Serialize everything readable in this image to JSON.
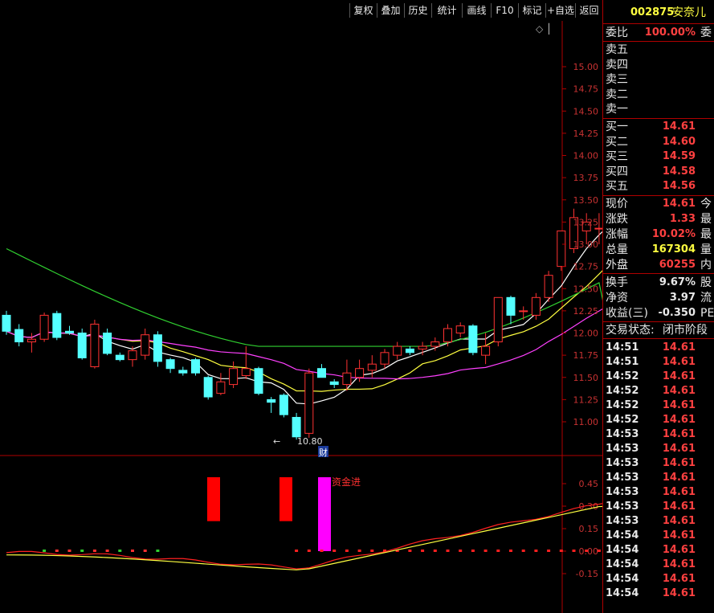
{
  "toolbar": {
    "buttons": [
      "复权",
      "叠加",
      "历史",
      "统计",
      "画线",
      "F10",
      "标记",
      "+自选",
      "返回"
    ]
  },
  "chart": {
    "price_ticks": [
      "15.00",
      "14.75",
      "14.50",
      "14.25",
      "14.00",
      "13.75",
      "13.50",
      "13.25",
      "13.00",
      "12.75",
      "12.50",
      "12.25",
      "12.00",
      "11.75",
      "11.50",
      "11.25",
      "11.00"
    ],
    "low_marker": "10.80",
    "finance_badge": "财",
    "signal_label": "资金进",
    "indicator_ticks": [
      "0.45",
      "0.30",
      "0.15",
      "0.00",
      "-0.15"
    ],
    "diamond_icon": "◇",
    "bar_icon": "▏"
  },
  "chart_data": {
    "type": "candlestick",
    "price_range": [
      10.75,
      15.25
    ],
    "candles": [
      {
        "o": 12.2,
        "h": 12.25,
        "l": 11.98,
        "c": 12.02
      },
      {
        "o": 12.04,
        "h": 12.1,
        "l": 11.85,
        "c": 11.9
      },
      {
        "o": 11.9,
        "h": 12.0,
        "l": 11.78,
        "c": 11.93
      },
      {
        "o": 11.93,
        "h": 12.23,
        "l": 11.9,
        "c": 12.2
      },
      {
        "o": 12.22,
        "h": 12.25,
        "l": 11.92,
        "c": 11.95
      },
      {
        "o": 12.02,
        "h": 12.08,
        "l": 11.98,
        "c": 12.0
      },
      {
        "o": 12.0,
        "h": 12.05,
        "l": 11.7,
        "c": 11.72
      },
      {
        "o": 11.62,
        "h": 12.15,
        "l": 11.6,
        "c": 12.1
      },
      {
        "o": 12.0,
        "h": 12.05,
        "l": 11.75,
        "c": 11.77
      },
      {
        "o": 11.75,
        "h": 11.78,
        "l": 11.68,
        "c": 11.7
      },
      {
        "o": 11.7,
        "h": 11.85,
        "l": 11.62,
        "c": 11.8
      },
      {
        "o": 11.75,
        "h": 12.05,
        "l": 11.7,
        "c": 11.98
      },
      {
        "o": 11.98,
        "h": 12.02,
        "l": 11.62,
        "c": 11.68
      },
      {
        "o": 11.7,
        "h": 11.72,
        "l": 11.55,
        "c": 11.6
      },
      {
        "o": 11.58,
        "h": 11.62,
        "l": 11.52,
        "c": 11.55
      },
      {
        "o": 11.7,
        "h": 11.72,
        "l": 11.52,
        "c": 11.55
      },
      {
        "o": 11.5,
        "h": 11.52,
        "l": 11.25,
        "c": 11.28
      },
      {
        "o": 11.32,
        "h": 11.55,
        "l": 11.3,
        "c": 11.45
      },
      {
        "o": 11.42,
        "h": 11.68,
        "l": 11.38,
        "c": 11.6
      },
      {
        "o": 11.52,
        "h": 11.85,
        "l": 11.48,
        "c": 11.6
      },
      {
        "o": 11.6,
        "h": 11.62,
        "l": 11.3,
        "c": 11.32
      },
      {
        "o": 11.25,
        "h": 11.28,
        "l": 11.1,
        "c": 11.22
      },
      {
        "o": 11.3,
        "h": 11.32,
        "l": 11.05,
        "c": 11.08
      },
      {
        "o": 11.05,
        "h": 11.1,
        "l": 10.8,
        "c": 10.83
      },
      {
        "o": 10.87,
        "h": 11.6,
        "l": 10.82,
        "c": 11.55
      },
      {
        "o": 11.6,
        "h": 11.65,
        "l": 11.5,
        "c": 11.5
      },
      {
        "o": 11.45,
        "h": 11.48,
        "l": 11.38,
        "c": 11.42
      },
      {
        "o": 11.42,
        "h": 11.7,
        "l": 11.35,
        "c": 11.55
      },
      {
        "o": 11.5,
        "h": 11.7,
        "l": 11.45,
        "c": 11.6
      },
      {
        "o": 11.58,
        "h": 11.75,
        "l": 11.5,
        "c": 11.65
      },
      {
        "o": 11.65,
        "h": 11.82,
        "l": 11.6,
        "c": 11.78
      },
      {
        "o": 11.75,
        "h": 11.9,
        "l": 11.7,
        "c": 11.85
      },
      {
        "o": 11.82,
        "h": 11.85,
        "l": 11.75,
        "c": 11.78
      },
      {
        "o": 11.82,
        "h": 11.9,
        "l": 11.75,
        "c": 11.85
      },
      {
        "o": 11.85,
        "h": 11.95,
        "l": 11.8,
        "c": 11.9
      },
      {
        "o": 11.9,
        "h": 12.1,
        "l": 11.85,
        "c": 12.05
      },
      {
        "o": 12.0,
        "h": 12.12,
        "l": 11.95,
        "c": 12.08
      },
      {
        "o": 12.08,
        "h": 12.1,
        "l": 11.75,
        "c": 11.78
      },
      {
        "o": 11.75,
        "h": 12.0,
        "l": 11.65,
        "c": 11.85
      },
      {
        "o": 11.9,
        "h": 12.4,
        "l": 11.85,
        "c": 12.4
      },
      {
        "o": 12.4,
        "h": 12.42,
        "l": 12.1,
        "c": 12.2
      },
      {
        "o": 12.25,
        "h": 12.3,
        "l": 12.15,
        "c": 12.25
      },
      {
        "o": 12.2,
        "h": 12.45,
        "l": 12.15,
        "c": 12.4
      },
      {
        "o": 12.4,
        "h": 12.7,
        "l": 12.35,
        "c": 12.65
      },
      {
        "o": 12.75,
        "h": 13.15,
        "l": 12.7,
        "c": 13.15
      },
      {
        "o": 12.95,
        "h": 13.4,
        "l": 12.9,
        "c": 13.3
      },
      {
        "o": 13.15,
        "h": 13.35,
        "l": 13.0,
        "c": 13.25
      },
      {
        "o": 13.18,
        "h": 13.35,
        "l": 13.0,
        "c": 13.18
      },
      {
        "o": 13.25,
        "h": 13.35,
        "l": 13.1,
        "c": 13.3
      }
    ],
    "ma_yellow_end": 12.55,
    "ma_white_end": 13.08,
    "ma_magenta_end": 12.2,
    "ma_green_end": 11.9,
    "indicator_range": [
      -0.3,
      0.55
    ],
    "indicator_red_end": 0.33,
    "indicator_yellow_end": 0.3,
    "signal_bars": [
      {
        "type": "red",
        "top": 0.45,
        "bottom": 0.2
      },
      {
        "type": "red",
        "top": 0.45,
        "bottom": 0.2
      },
      {
        "type": "magenta",
        "top": 0.45,
        "bottom": 0.0
      }
    ]
  },
  "panel": {
    "code": "002875",
    "name": "安奈儿",
    "weibi_label": "委比",
    "weibi_value": "100.00%",
    "weibi_end": "委",
    "sell_labels": [
      "卖五",
      "卖四",
      "卖三",
      "卖二",
      "卖一"
    ],
    "buy": [
      {
        "label": "买一",
        "price": "14.61"
      },
      {
        "label": "买二",
        "price": "14.60"
      },
      {
        "label": "买三",
        "price": "14.59"
      },
      {
        "label": "买四",
        "price": "14.58"
      },
      {
        "label": "买五",
        "price": "14.56"
      }
    ],
    "stats": [
      {
        "label": "现价",
        "value": "14.61",
        "end": "今",
        "color": "#ff4040"
      },
      {
        "label": "涨跌",
        "value": "1.33",
        "end": "最",
        "color": "#ff4040"
      },
      {
        "label": "涨幅",
        "value": "10.02%",
        "end": "最",
        "color": "#ff4040"
      },
      {
        "label": "总量",
        "value": "167304",
        "end": "量",
        "color": "#ffff40"
      },
      {
        "label": "外盘",
        "value": "60255",
        "end": "内",
        "color": "#ff4040"
      }
    ],
    "stats2": [
      {
        "label": "换手",
        "value": "9.67%",
        "end": "股",
        "color": "#e8e8e8"
      },
      {
        "label": "净资",
        "value": "3.97",
        "end": "流",
        "color": "#e8e8e8"
      },
      {
        "label": "收益(三)",
        "value": "-0.350",
        "end": "PE",
        "color": "#e8e8e8"
      }
    ],
    "trade_status_label": "交易状态:",
    "trade_status_value": "闭市阶段",
    "ticks": [
      {
        "t": "14:51",
        "p": "14.61"
      },
      {
        "t": "14:51",
        "p": "14.61"
      },
      {
        "t": "14:52",
        "p": "14.61"
      },
      {
        "t": "14:52",
        "p": "14.61"
      },
      {
        "t": "14:52",
        "p": "14.61"
      },
      {
        "t": "14:52",
        "p": "14.61"
      },
      {
        "t": "14:53",
        "p": "14.61"
      },
      {
        "t": "14:53",
        "p": "14.61"
      },
      {
        "t": "14:53",
        "p": "14.61"
      },
      {
        "t": "14:53",
        "p": "14.61"
      },
      {
        "t": "14:53",
        "p": "14.61"
      },
      {
        "t": "14:53",
        "p": "14.61"
      },
      {
        "t": "14:53",
        "p": "14.61"
      },
      {
        "t": "14:54",
        "p": "14.61"
      },
      {
        "t": "14:54",
        "p": "14.61"
      },
      {
        "t": "14:54",
        "p": "14.61"
      },
      {
        "t": "14:54",
        "p": "14.61"
      },
      {
        "t": "14:54",
        "p": "14.61"
      }
    ]
  }
}
